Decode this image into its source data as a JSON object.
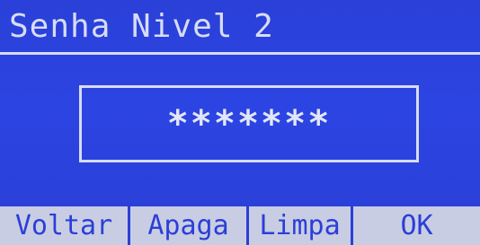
{
  "screen": {
    "title": "Senha Nivel 2",
    "password_masked": "*******"
  },
  "softkeys": {
    "back": "Voltar",
    "delete": "Apaga",
    "clear": "Limpa",
    "ok": "OK"
  },
  "colors": {
    "background": "#2a3fd6",
    "foreground": "#d8dcf4",
    "softkey_background": "#c9cde3"
  }
}
